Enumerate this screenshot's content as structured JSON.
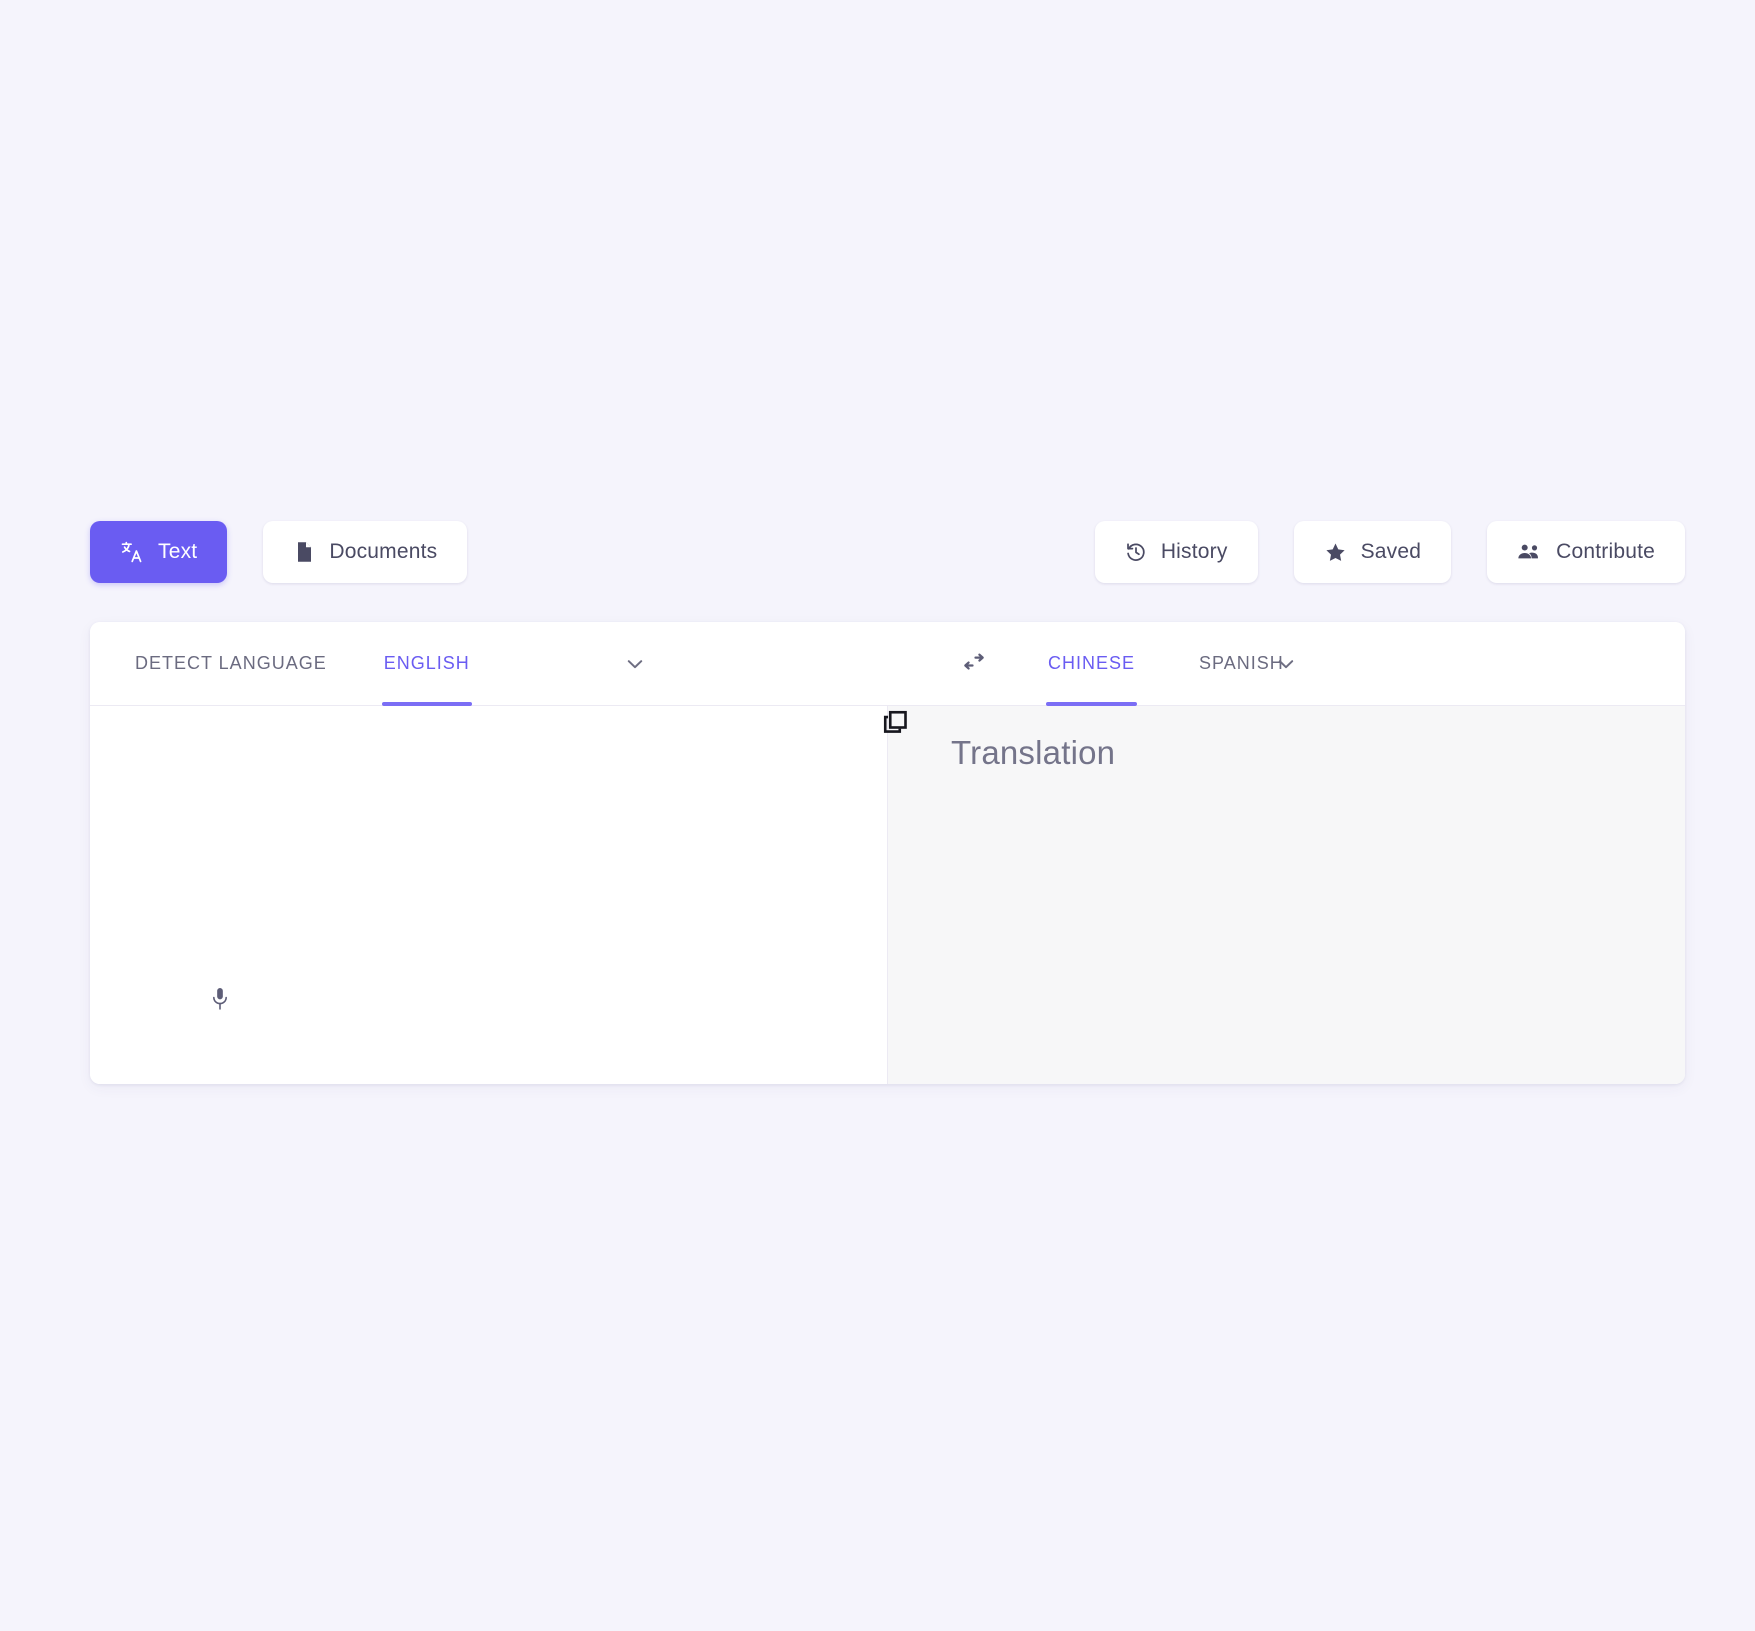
{
  "theme": {
    "page_background": "#f5f4fc",
    "accent": "#6a5cf2",
    "card_background": "#ffffff",
    "output_panel_background": "#f7f7f8",
    "muted_text": "#6b6b80"
  },
  "toolbar": {
    "left": [
      {
        "id": "text",
        "label": "Text",
        "icon": "translate-icon",
        "active": true
      },
      {
        "id": "documents",
        "label": "Documents",
        "icon": "document-icon",
        "active": false
      }
    ],
    "right": [
      {
        "id": "history",
        "label": "History",
        "icon": "history-icon",
        "active": false
      },
      {
        "id": "saved",
        "label": "Saved",
        "icon": "star-icon",
        "active": false
      },
      {
        "id": "contribute",
        "label": "Contribute",
        "icon": "people-icon",
        "active": false
      }
    ]
  },
  "translator": {
    "source": {
      "options": [
        {
          "id": "detect",
          "label": "DETECT LANGUAGE",
          "selected": false
        },
        {
          "id": "english",
          "label": "ENGLISH",
          "selected": true
        }
      ],
      "dropdown_icon": "chevron-down-icon",
      "input_value": "",
      "input_placeholder": "",
      "mic_icon": "microphone-icon"
    },
    "swap": {
      "icon": "swap-horizontal-icon"
    },
    "target": {
      "options": [
        {
          "id": "chinese",
          "label": "CHINESE",
          "selected": true
        },
        {
          "id": "spanish",
          "label": "SPANISH",
          "selected": false
        }
      ],
      "dropdown_icon": "chevron-down-icon",
      "output_placeholder": "Translation",
      "copy_icon": "copy-icon"
    }
  }
}
